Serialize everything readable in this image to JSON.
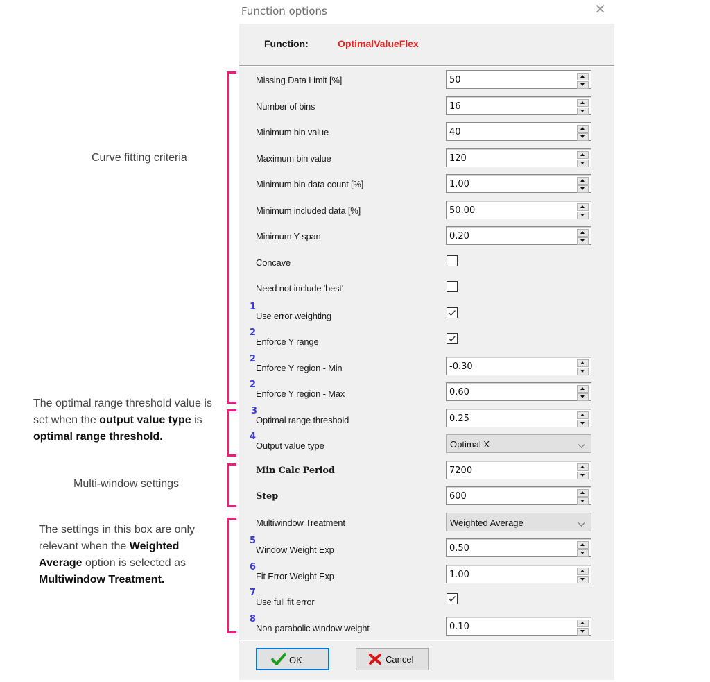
{
  "window": {
    "title": "Function options",
    "close_icon": "close-x-icon"
  },
  "header": {
    "function_label": "Function:",
    "function_name": "OptimalValueFlex",
    "function_name_color": "#f02020"
  },
  "fields": [
    {
      "label": "Missing Data Limit [%]",
      "type": "spin",
      "value": "50",
      "marker": ""
    },
    {
      "label": "Number of bins",
      "type": "spin",
      "value": "16",
      "marker": ""
    },
    {
      "label": "Minimum bin value",
      "type": "spin",
      "value": "40",
      "marker": ""
    },
    {
      "label": "Maximum bin value",
      "type": "spin",
      "value": "120",
      "marker": ""
    },
    {
      "label": "Minimum bin data count [%]",
      "type": "spin",
      "value": "1.00",
      "marker": ""
    },
    {
      "label": "Minimum included data [%]",
      "type": "spin",
      "value": "50.00",
      "marker": ""
    },
    {
      "label": "Minimum Y span",
      "type": "spin",
      "value": "0.20",
      "marker": ""
    },
    {
      "label": "Concave",
      "type": "check",
      "checked": false,
      "marker": ""
    },
    {
      "label": "Need not include 'best'",
      "type": "check",
      "checked": false,
      "marker": ""
    },
    {
      "label": "Use error weighting",
      "type": "check",
      "checked": true,
      "marker": "1"
    },
    {
      "label": "Enforce Y range",
      "type": "check",
      "checked": true,
      "marker": "2"
    },
    {
      "label": "Enforce Y region - Min",
      "type": "spin",
      "value": "-0.30",
      "marker": "2"
    },
    {
      "label": "Enforce Y region - Max",
      "type": "spin",
      "value": "0.60",
      "marker": "2"
    },
    {
      "label": "Optimal range threshold",
      "type": "spin",
      "value": "0.25",
      "marker": "3"
    },
    {
      "label": "Output value type",
      "type": "combo",
      "value": "Optimal X",
      "marker": "4"
    },
    {
      "label": "Min Calc Period",
      "type": "spin",
      "value": "7200",
      "marker": "",
      "bold": true
    },
    {
      "label": "Step",
      "type": "spin",
      "value": "600",
      "marker": "",
      "bold": true
    },
    {
      "label": "Multiwindow Treatment",
      "type": "combo",
      "value": "Weighted Average",
      "marker": ""
    },
    {
      "label": "Window Weight Exp",
      "type": "spin",
      "value": "0.50",
      "marker": "5"
    },
    {
      "label": "Fit Error Weight Exp",
      "type": "spin",
      "value": "1.00",
      "marker": "6"
    },
    {
      "label": "Use full fit error",
      "type": "check",
      "checked": true,
      "marker": "7"
    },
    {
      "label": "Non-parabolic window weight",
      "type": "spin",
      "value": "0.10",
      "marker": "8"
    }
  ],
  "buttons": {
    "ok": "OK",
    "cancel": "Cancel"
  },
  "annotations": {
    "curve_fitting": "Curve fitting criteria",
    "optimal_range": {
      "p1": "The optimal range threshold value is set when the ",
      "b1": "output value type",
      "p2": " is ",
      "b2": "optimal range threshold."
    },
    "multi_window": "Multi-window settings",
    "weighted_avg": {
      "p1": "The settings in this box are only relevant when the ",
      "b1": "Weighted Average",
      "p2": " option is selected as ",
      "b2": "Multiwindow Treatment."
    },
    "bracket_color": "#ee1c7c",
    "marker_color": "#3a3adf"
  }
}
